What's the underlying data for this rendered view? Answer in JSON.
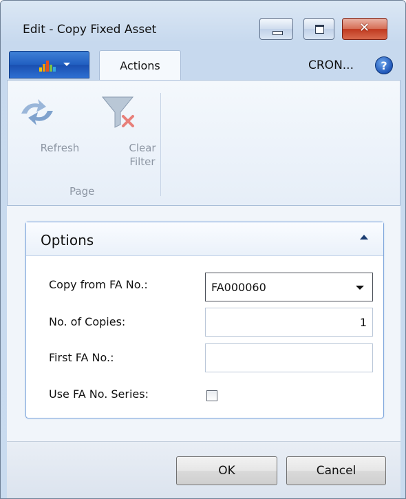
{
  "window": {
    "title": "Edit - Copy Fixed Asset"
  },
  "ribbon": {
    "tab_actions": "Actions",
    "company": "CRON...",
    "help": "?",
    "buttons": {
      "refresh": "Refresh",
      "clear_filter_line1": "Clear",
      "clear_filter_line2": "Filter"
    },
    "group_label": "Page"
  },
  "options": {
    "title": "Options",
    "fields": {
      "copy_from_label": "Copy from FA No.:",
      "copy_from_value": "FA000060",
      "copies_label": "No. of Copies:",
      "copies_value": "1",
      "first_fa_label": "First FA No.:",
      "first_fa_value": "",
      "use_series_label": "Use FA No. Series:",
      "use_series_checked": false
    }
  },
  "footer": {
    "ok": "OK",
    "cancel": "Cancel"
  },
  "colors": {
    "window_bg": "#c9dbef",
    "accent_blue": "#215fc1",
    "close_red": "#c0391f"
  }
}
